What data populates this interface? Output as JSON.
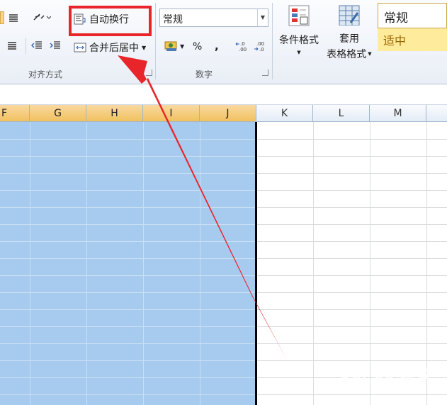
{
  "ribbon": {
    "alignment": {
      "wrap_text_label": "自动换行",
      "merge_center_label": "合并后居中",
      "group_label": "对齐方式"
    },
    "number": {
      "format_value": "常规",
      "percent_label": "%",
      "comma_label": ",",
      "inc_decimal_label": "←.0 .00",
      "dec_decimal_label": ".00 →.0",
      "group_label": "数字"
    },
    "styles": {
      "conditional_format_label": "条件格式",
      "table_format_label_1": "套用",
      "table_format_label_2": "表格格式",
      "normal_style_label": "常规",
      "neutral_style_label": "适中"
    }
  },
  "columns": [
    "F",
    "G",
    "H",
    "I",
    "J",
    "K",
    "L",
    "M"
  ],
  "selected_columns": [
    "F",
    "G",
    "H",
    "I",
    "J"
  ],
  "watermark": {
    "brand": "Bai du 经验",
    "url": "jingyan.baidu.com"
  },
  "colors": {
    "selection": "#a6cbee",
    "header_selected": "#f1c15f",
    "annotation": "#e8252a"
  }
}
